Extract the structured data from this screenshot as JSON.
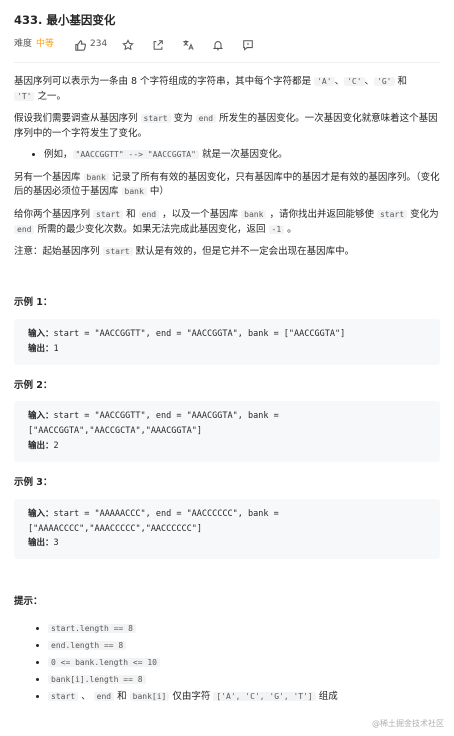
{
  "header": {
    "title": "433. 最小基因变化",
    "difficulty_label": "难度",
    "difficulty": "中等",
    "likes": "234"
  },
  "desc": {
    "p1_a": "基因序列可以表示为一条由 8 个字符组成的字符串，其中每个字符都是 ",
    "p1_c1": "'A'",
    "p1_s1": "、",
    "p1_c2": "'C'",
    "p1_s2": "、",
    "p1_c3": "'G'",
    "p1_s3": " 和",
    "p1_c4": "'T'",
    "p1_b": " 之一。",
    "p2_a": "假设我们需要调查从基因序列 ",
    "p2_c1": "start",
    "p2_b": " 变为 ",
    "p2_c2": "end",
    "p2_c": " 所发生的基因变化。一次基因变化就意味着这个基因序列中的一个字符发生了变化。",
    "ex_a": "例如，",
    "ex_c1": "\"AACCGGTT\" --> \"AACCGGTA\"",
    "ex_b": " 就是一次基因变化。",
    "p3_a": "另有一个基因库 ",
    "p3_c1": "bank",
    "p3_b": " 记录了所有有效的基因变化，只有基因库中的基因才是有效的基因序列。（变化后的基因必须位于基因库 ",
    "p3_c2": "bank",
    "p3_c": " 中）",
    "p4_a": "给你两个基因序列 ",
    "p4_c1": "start",
    "p4_b": " 和 ",
    "p4_c2": "end",
    "p4_c": " ，以及一个基因库 ",
    "p4_c3": "bank",
    "p4_d": " ，请你找出并返回能够使 ",
    "p4_c4": "start",
    "p4_e": " 变化为 ",
    "p4_c5": "end",
    "p4_f": " 所需的最少变化次数。如果无法完成此基因变化，返回 ",
    "p4_c6": "-1",
    "p4_g": " 。",
    "p5_a": "注意：起始基因序列 ",
    "p5_c1": "start",
    "p5_b": " 默认是有效的，但是它并不一定会出现在基因库中。"
  },
  "examples": [
    {
      "heading": "示例 1：",
      "input_label": "输入：",
      "input": "start = \"AACCGGTT\", end = \"AACCGGTA\", bank = [\"AACCGGTA\"]",
      "output_label": "输出：",
      "output": "1"
    },
    {
      "heading": "示例 2：",
      "input_label": "输入：",
      "input_line1": "start = \"AACCGGTT\", end = \"AAACGGTA\", bank =",
      "input_line2": "[\"AACCGGTA\",\"AACCGCTA\",\"AAACGGTA\"]",
      "output_label": "输出：",
      "output": "2"
    },
    {
      "heading": "示例 3：",
      "input_label": "输入：",
      "input_line1": "start = \"AAAAACCC\", end = \"AACCCCCC\", bank =",
      "input_line2": "[\"AAAACCCC\",\"AAACCCCC\",\"AACCCCCC\"]",
      "output_label": "输出：",
      "output": "3"
    }
  ],
  "hints": {
    "heading": "提示：",
    "h1": "start.length == 8",
    "h2": "end.length == 8",
    "h3": "0 <= bank.length <= 10",
    "h4": "bank[i].length == 8",
    "h5_c1": "start",
    "h5_s1": " 、 ",
    "h5_c2": "end",
    "h5_s2": " 和 ",
    "h5_c3": "bank[i]",
    "h5_s3": " 仅由字符 ",
    "h5_c4": "['A', 'C', 'G', 'T']",
    "h5_s4": " 组成"
  },
  "watermark": "@稀土掘金技术社区"
}
